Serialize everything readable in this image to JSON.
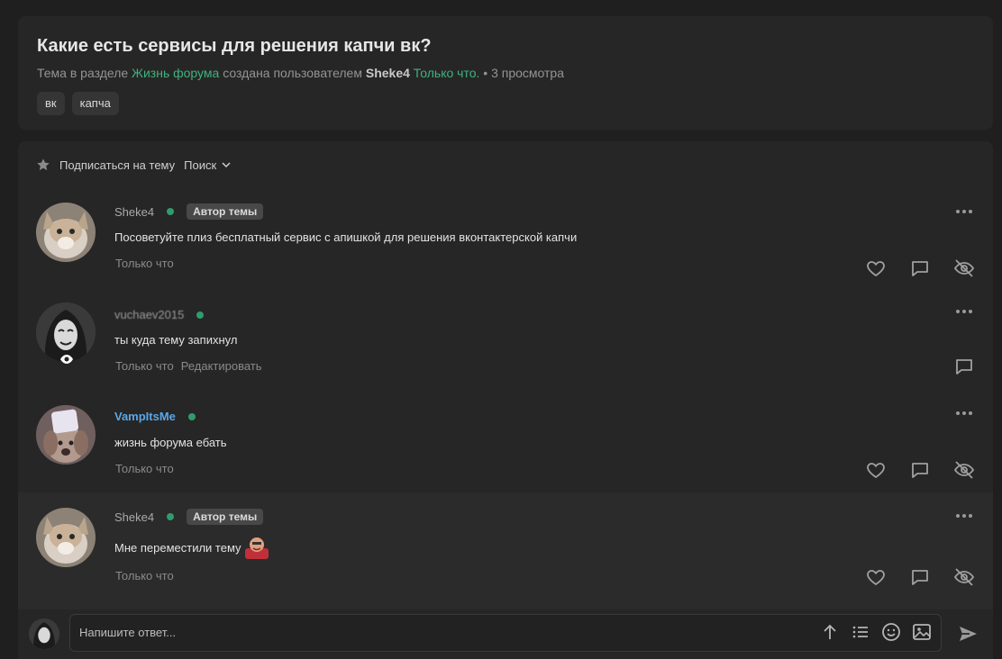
{
  "thread": {
    "title": "Какие есть сервисы для решения капчи вк?",
    "meta_prefix": "Тема в разделе",
    "section": "Жизнь форума",
    "meta_created_by": "создана пользователем",
    "author": "Sheke4",
    "time": "Только что.",
    "views": "• 3 просмотра",
    "tags": [
      "вк",
      "капча"
    ]
  },
  "toolbar": {
    "subscribe_label": "Подписаться на тему",
    "search_label": "Поиск"
  },
  "posts": [
    {
      "author": "Sheke4",
      "badge": "Автор темы",
      "text": "Посоветуйте плиз бесплатный сервис с апишкой для решения вконтактерской капчи",
      "time": "Только что"
    },
    {
      "author": "vuchaev2015",
      "text": "ты куда тему запихнул",
      "time": "Только что",
      "edit": "Редактировать"
    },
    {
      "author": "VampItsMe",
      "text": "жизнь форума ебать",
      "time": "Только что"
    },
    {
      "author": "Sheke4",
      "badge": "Автор темы",
      "text": "Мне переместили тему",
      "time": "Только что"
    }
  ],
  "reply": {
    "placeholder": "Напишите ответ..."
  },
  "colors": {
    "accent_green": "#3fb27f",
    "online_dot": "#2f9c6c",
    "username_blue": "#5aa7e6"
  }
}
